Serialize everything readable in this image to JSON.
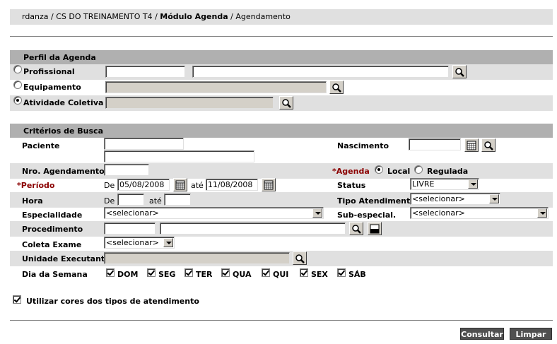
{
  "breadcrumb": {
    "part1": "rdanza / CS DO TREINAMENTO T4 /",
    "part2": "Módulo Agenda",
    "part3": "/ Agendamento"
  },
  "perfil": {
    "title": "Perfil da Agenda",
    "profissional": "Profissional",
    "equipamento": "Equipamento",
    "atividade": "Atividade Coletiva"
  },
  "criterios": {
    "title": "Critérios de Busca",
    "paciente": "Paciente",
    "nascimento": "Nascimento",
    "nro_agendamento": "Nro. Agendamento",
    "agenda_star": "*",
    "agenda": "Agenda",
    "local": "Local",
    "regulada": "Regulada",
    "periodo_star": "*",
    "periodo": "Período",
    "de": "De",
    "ate": "até",
    "periodo_de": "05/08/2008",
    "periodo_ate": "11/08/2008",
    "status": "Status",
    "status_value": "LIVRE",
    "hora": "Hora",
    "tipo_atendimento": "Tipo Atendimento",
    "tipo_atendimento_value": "<selecionar>",
    "especialidade": "Especialidade",
    "especialidade_value": "<selecionar>",
    "sub_especial": "Sub-especial.",
    "sub_especial_value": "<selecionar>",
    "procedimento": "Procedimento",
    "coleta_exame": "Coleta Exame",
    "coleta_exame_value": "<selecionar>",
    "unidade_executante": "Unidade Executante",
    "dia_semana": "Dia da Semana",
    "days": [
      "DOM",
      "SEG",
      "TER",
      "QUA",
      "QUI",
      "SEX",
      "SÁB"
    ]
  },
  "utilizar_cores": "Utilizar cores dos tipos de atendimento",
  "buttons": {
    "consultar": "Consultar",
    "limpar": "Limpar"
  }
}
